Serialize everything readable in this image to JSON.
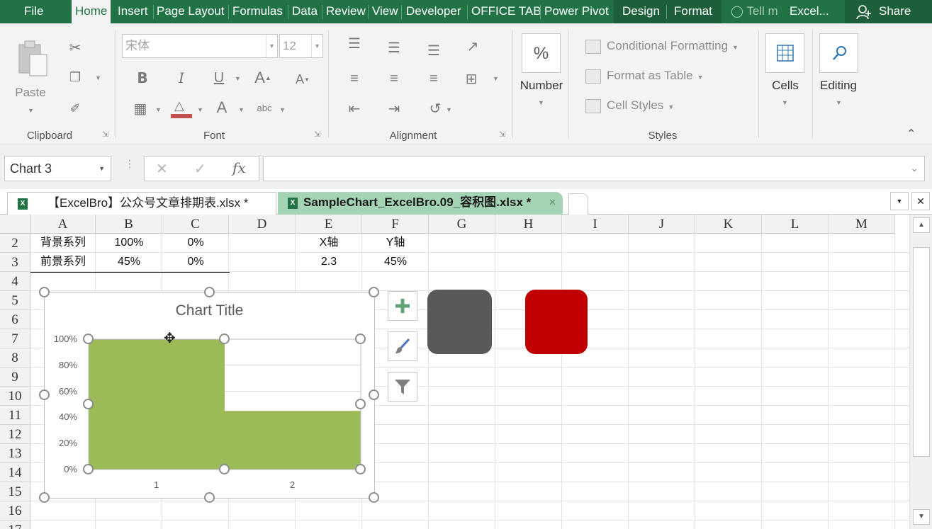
{
  "ribbon_tabs": [
    {
      "label": "File",
      "active": false
    },
    {
      "label": "Home",
      "active": true
    },
    {
      "label": "Insert",
      "active": false
    },
    {
      "label": "Page Layout",
      "active": false
    },
    {
      "label": "Formulas",
      "active": false
    },
    {
      "label": "Data",
      "active": false
    },
    {
      "label": "Review",
      "active": false
    },
    {
      "label": "View",
      "active": false
    },
    {
      "label": "Developer",
      "active": false
    },
    {
      "label": "OFFICE TAB",
      "active": false
    },
    {
      "label": "Power Pivot",
      "active": false
    },
    {
      "label": "Design",
      "active": false
    },
    {
      "label": "Format",
      "active": false
    }
  ],
  "tell_me": "Tell m",
  "user": "Excel...",
  "share_label": "Share",
  "clipboard": {
    "paste_label": "Paste",
    "group_label": "Clipboard"
  },
  "font": {
    "name": "宋体",
    "size": "12",
    "group_label": "Font"
  },
  "alignment": {
    "group_label": "Alignment"
  },
  "number": {
    "label": "Number",
    "symbol": "%"
  },
  "styles": {
    "conditional_formatting": "Conditional Formatting",
    "format_as_table": "Format as Table",
    "cell_styles": "Cell Styles",
    "group_label": "Styles"
  },
  "cells_label": "Cells",
  "editing_label": "Editing",
  "name_box": "Chart 3",
  "formula_value": "",
  "doc_tabs": [
    {
      "label": "【ExcelBro】公众号文章排期表.xlsx *",
      "active": false
    },
    {
      "label": "SampleChart_ExcelBro.09_容积图.xlsx *",
      "active": true
    }
  ],
  "columns": [
    "A",
    "B",
    "C",
    "D",
    "E",
    "F",
    "G",
    "H",
    "I",
    "J",
    "K",
    "L",
    "M"
  ],
  "rows": [
    "2",
    "3",
    "4",
    "5",
    "6",
    "7",
    "8",
    "9",
    "10",
    "11",
    "12",
    "13",
    "14",
    "15",
    "16",
    "17"
  ],
  "cells": {
    "A2": "背景系列",
    "B2": "100%",
    "C2": "0%",
    "E2": "X轴",
    "F2": "Y轴",
    "A3": "前景系列",
    "B3": "45%",
    "C3": "0%",
    "E3": "2.3",
    "F3": "45%"
  },
  "chart_data": {
    "type": "area",
    "title": "Chart Title",
    "categories": [
      "1",
      "2"
    ],
    "y_ticks": [
      "100%",
      "80%",
      "60%",
      "40%",
      "20%",
      "0%"
    ],
    "ylim": [
      0,
      1
    ],
    "step_x": 2.3,
    "series": [
      {
        "values": [
          1.0,
          0.0
        ]
      },
      {
        "values": [
          0.45,
          0.0
        ]
      }
    ],
    "fill_color": "#9bbb59",
    "grid": true,
    "legend": "none"
  },
  "chart_buttons": [
    "plus-icon",
    "brush-icon",
    "filter-icon"
  ],
  "shapes": [
    {
      "color": "#595959"
    },
    {
      "color": "#c00000"
    }
  ],
  "colors": {
    "accent": "#217346",
    "active_doc_tab": "#a3d5b4"
  }
}
